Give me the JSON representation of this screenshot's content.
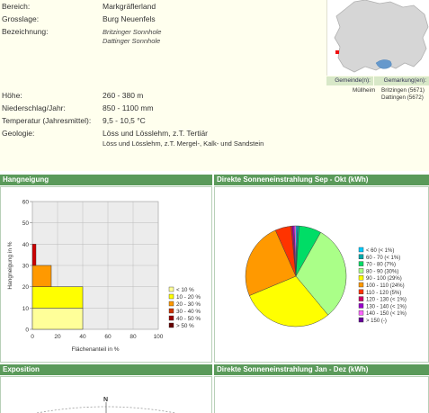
{
  "info": {
    "rows": [
      {
        "label": "Bereich:",
        "value": "Markgräflerland"
      },
      {
        "label": "Grosslage:",
        "value": "Burg Neuenfels"
      },
      {
        "label": "Bezeichnung:",
        "values": [
          "Britzinger Sonnhole",
          "Dattinger Sonnhole"
        ]
      },
      {
        "label": "Höhe:",
        "value": "260 - 380 m"
      },
      {
        "label": "Niederschlag/Jahr:",
        "value": "850 - 1100 mm"
      },
      {
        "label": "Temperatur (Jahresmittel):",
        "value": "9,5 - 10,5 °C"
      },
      {
        "label": "Geologie:",
        "value": "Löss und Lösslehm, z.T. Tertiär",
        "value2": "Löss und Lösslehm, z.T. Mergel-, Kalk- und Sandstein"
      }
    ]
  },
  "gemeinde": {
    "headers": [
      "Gemeinde(n):",
      "Gemarkung(en):"
    ],
    "municipality": "Müllheim",
    "districts": [
      "Britzingen (5671)",
      "Dattingen (5672)"
    ]
  },
  "colors": {
    "header_bg": "#5a9a5a",
    "info_bg": "#ffffee",
    "panel_bg": "#eaf3ea"
  },
  "sections": {
    "hangneigung": "Hangneigung",
    "sonne_sep_okt": "Direkte Sonneneinstrahlung Sep - Okt (kWh)",
    "exposition": "Exposition",
    "sonne_jan_dez": "Direkte Sonneneinstrahlung Jan - Dez (kWh)"
  },
  "compass": {
    "north": "N"
  },
  "chart_data": [
    {
      "type": "bar",
      "orientation": "horizontal",
      "xlabel": "Flächenanteil in %",
      "ylabel": "Hangneigung in %",
      "xlim": [
        0,
        100
      ],
      "ylim": [
        0,
        60
      ],
      "xticks": [
        0,
        20,
        40,
        60,
        80,
        100
      ],
      "yticks": [
        0,
        10,
        20,
        30,
        40,
        50,
        60
      ],
      "bars": [
        {
          "from": 0,
          "to": 10,
          "value": 40,
          "category": "< 10 %",
          "color": "#ffff99"
        },
        {
          "from": 10,
          "to": 20,
          "value": 40,
          "category": "10 - 20 %",
          "color": "#ffff00"
        },
        {
          "from": 20,
          "to": 30,
          "value": 15,
          "category": "20 - 30 %",
          "color": "#ff9900"
        },
        {
          "from": 30,
          "to": 40,
          "value": 0,
          "category": "30 - 40 %",
          "color": "#cc3300"
        },
        {
          "from": 40,
          "to": 50,
          "value": 0,
          "category": "40 - 50 %",
          "color": "#990000"
        },
        {
          "from": 50,
          "to": 60,
          "value": 0,
          "category": "> 50 %",
          "color": "#660000"
        }
      ],
      "legend": [
        "< 10 %",
        "10 - 20 %",
        "20 - 30 %",
        "30 - 40 %",
        "40 - 50 %",
        "> 50 %"
      ],
      "legend_colors": [
        "#ffff99",
        "#ffff00",
        "#ff9900",
        "#cc3300",
        "#990000",
        "#660000"
      ],
      "grid": true
    },
    {
      "type": "pie",
      "slices": [
        {
          "label": "< 60 (< 1%)",
          "value": 0.5,
          "color": "#00ccff"
        },
        {
          "label": "60 - 70 (< 1%)",
          "value": 0.5,
          "color": "#00aaaa"
        },
        {
          "label": "70 - 80 (7%)",
          "value": 7,
          "color": "#00dd66"
        },
        {
          "label": "80 - 90 (30%)",
          "value": 30,
          "color": "#aaff88"
        },
        {
          "label": "90 - 100 (29%)",
          "value": 29,
          "color": "#ffff00"
        },
        {
          "label": "100 - 110 (24%)",
          "value": 24,
          "color": "#ff9900"
        },
        {
          "label": "110 - 120 (5%)",
          "value": 5,
          "color": "#ff3300"
        },
        {
          "label": "120 - 130 (< 1%)",
          "value": 0.5,
          "color": "#cc0066"
        },
        {
          "label": "130 - 140 (< 1%)",
          "value": 0.5,
          "color": "#9900cc"
        },
        {
          "label": "140 - 150 (< 1%)",
          "value": 0.5,
          "color": "#ff66ff"
        },
        {
          "label": "> 150 (-)",
          "value": 0,
          "color": "#660099"
        }
      ]
    }
  ]
}
